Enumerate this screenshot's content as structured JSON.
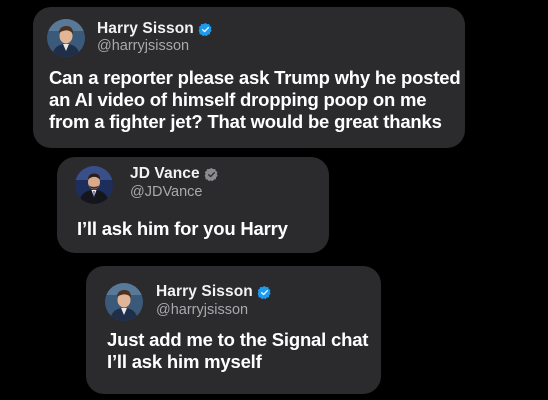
{
  "colors": {
    "background": "#000000",
    "card": "#2b2b2d",
    "name": "#f2f2f2",
    "handle": "#a9a9ad",
    "body_text": "#ffffff",
    "verified_badge": "#1d9bf0"
  },
  "posts": [
    {
      "author": {
        "name": "Harry Sisson",
        "handle": "@harryjsisson",
        "verified_icon": "verified-badge-icon",
        "avatar": "avatar-photo"
      },
      "lines": [
        "Can a reporter please ask Trump why he posted",
        "an AI video of himself dropping poop on me",
        "from a fighter jet? That would be great thanks"
      ]
    },
    {
      "author": {
        "name": "JD Vance",
        "handle": "@JDVance",
        "verified_icon": "verified-badge-icon",
        "avatar": "avatar-photo"
      },
      "lines": [
        "I’ll ask him for you Harry"
      ]
    },
    {
      "author": {
        "name": "Harry Sisson",
        "handle": "@harryjsisson",
        "verified_icon": "verified-badge-icon",
        "avatar": "avatar-photo"
      },
      "lines": [
        "Just add me to the Signal chat",
        "I’ll ask him myself"
      ]
    }
  ]
}
